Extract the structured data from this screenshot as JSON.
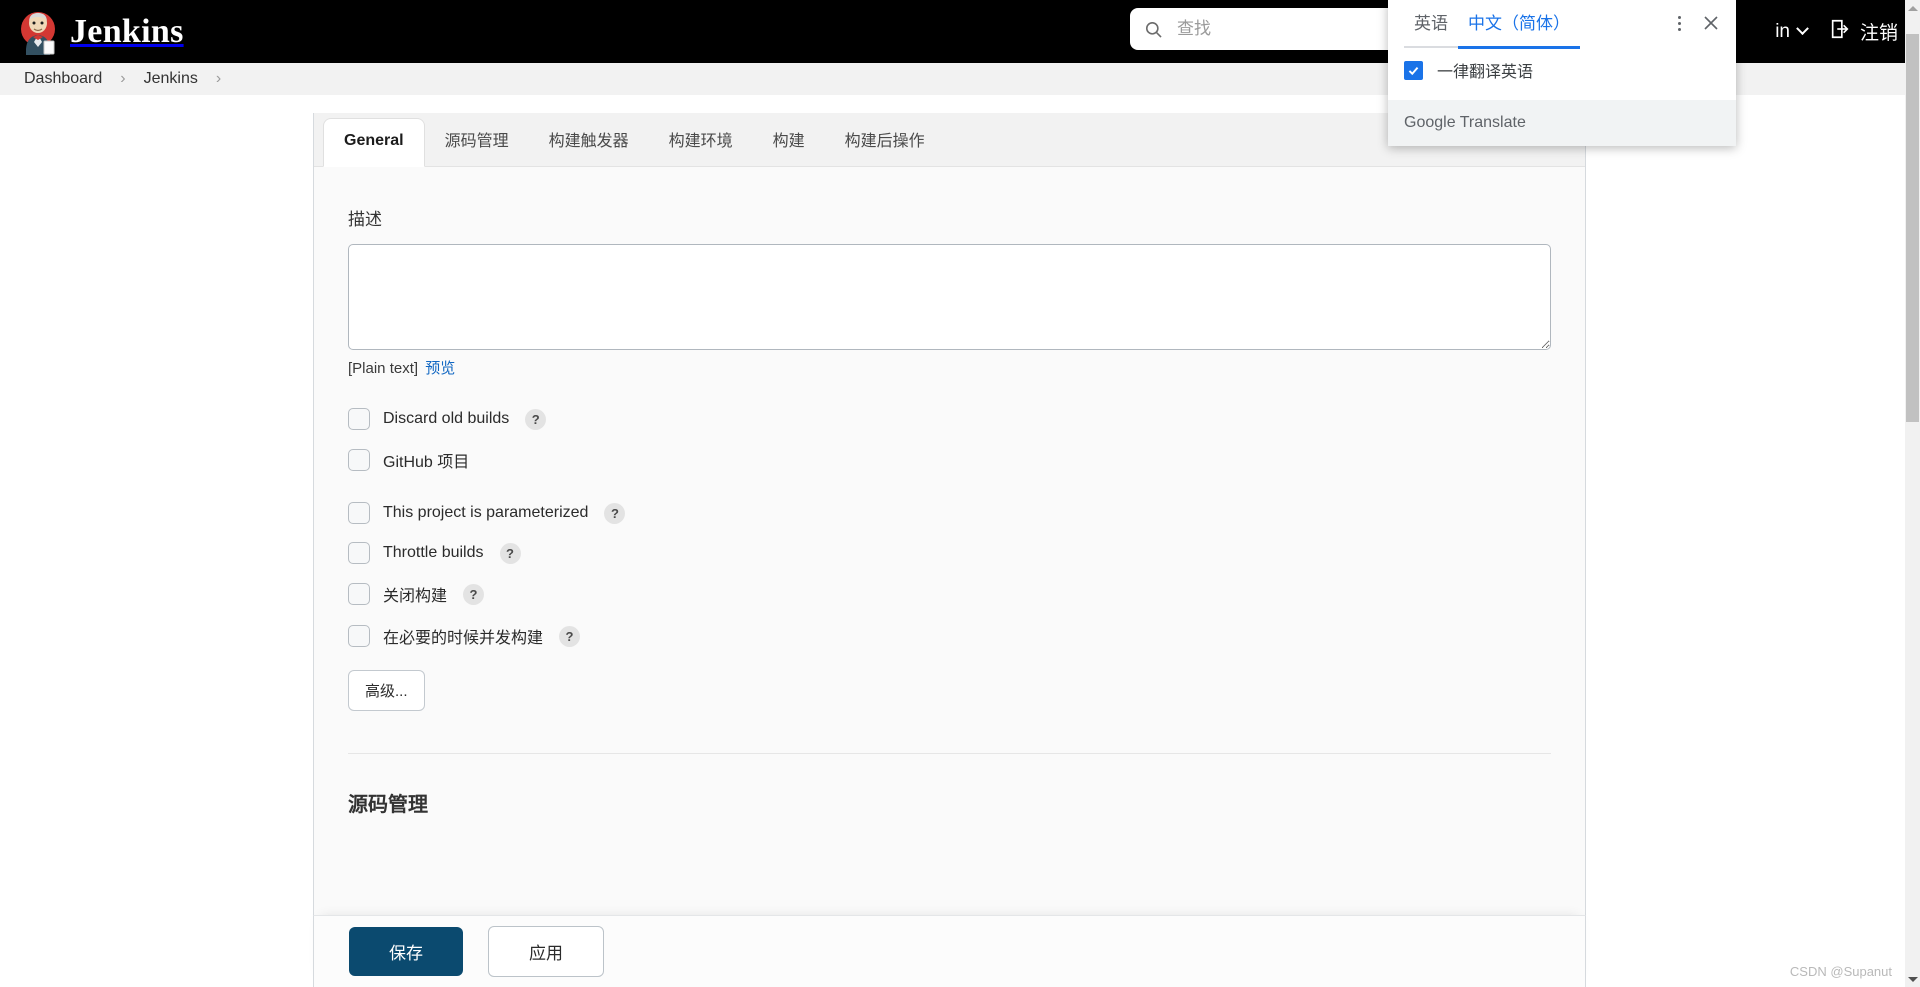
{
  "header": {
    "brand_title": "Jenkins",
    "logo_icon": "jenkins-butler-logo",
    "search": {
      "icon": "search-icon",
      "placeholder": "查找",
      "value": ""
    },
    "user_menu_label": "in",
    "user_menu_icon": "chevron-down-icon",
    "logout_label": "注销",
    "logout_icon": "logout-arrow-icon"
  },
  "breadcrumb": {
    "items": [
      {
        "label": "Dashboard"
      },
      {
        "label": "Jenkins"
      }
    ],
    "separator": "›"
  },
  "config": {
    "tabs": [
      {
        "label": "General",
        "active": true
      },
      {
        "label": "源码管理",
        "active": false
      },
      {
        "label": "构建触发器",
        "active": false
      },
      {
        "label": "构建环境",
        "active": false
      },
      {
        "label": "构建",
        "active": false
      },
      {
        "label": "构建后操作",
        "active": false
      }
    ],
    "description": {
      "label": "描述",
      "value": "",
      "plain_text_note": "[Plain text]",
      "preview_link": "预览"
    },
    "checkboxes": [
      {
        "label": "Discard old builds",
        "checked": false,
        "help": "?",
        "has_help": true
      },
      {
        "label": "GitHub 项目",
        "checked": false,
        "help": "?",
        "has_help": false
      },
      {
        "label": "This project is parameterized",
        "checked": false,
        "help": "?",
        "has_help": true
      },
      {
        "label": "Throttle builds",
        "checked": false,
        "help": "?",
        "has_help": true
      },
      {
        "label": "关闭构建",
        "checked": false,
        "help": "?",
        "has_help": true
      },
      {
        "label": "在必要的时候并发构建",
        "checked": false,
        "help": "?",
        "has_help": true
      }
    ],
    "advanced_button": "高级...",
    "scm_heading": "源码管理",
    "save_button": "保存",
    "apply_button": "应用"
  },
  "translate_popup": {
    "tabs": [
      {
        "label": "英语",
        "active": false
      },
      {
        "label": "中文（简体）",
        "active": true
      }
    ],
    "more_icon": "kebab-menu-icon",
    "close_icon": "close-icon",
    "always_translate_label": "一律翻译英语",
    "always_translate_checked": true,
    "footer_label": "Google Translate"
  },
  "watermark": "CSDN @Supanut",
  "colors": {
    "header_bg": "#000000",
    "accent_blue": "#1a73e8",
    "save_button": "#0b4a6f",
    "link_blue": "#1268c3"
  }
}
